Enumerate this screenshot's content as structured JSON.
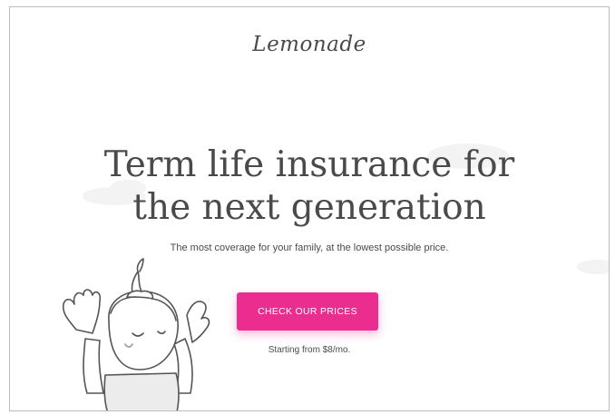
{
  "brand": {
    "logo_text": "Lemonade"
  },
  "hero": {
    "headline_line1": "Term life insurance for",
    "headline_line2": "the next generation",
    "subtext": "The most coverage for your family, at the lowest possible price.",
    "cta_label": "CHECK OUR PRICES",
    "price_note": "Starting from $8/mo."
  },
  "colors": {
    "accent": "#ea2d8e",
    "text": "#4a4a4a",
    "background": "#ffffff"
  },
  "icons": {
    "illustration": "child-character-illustration"
  }
}
